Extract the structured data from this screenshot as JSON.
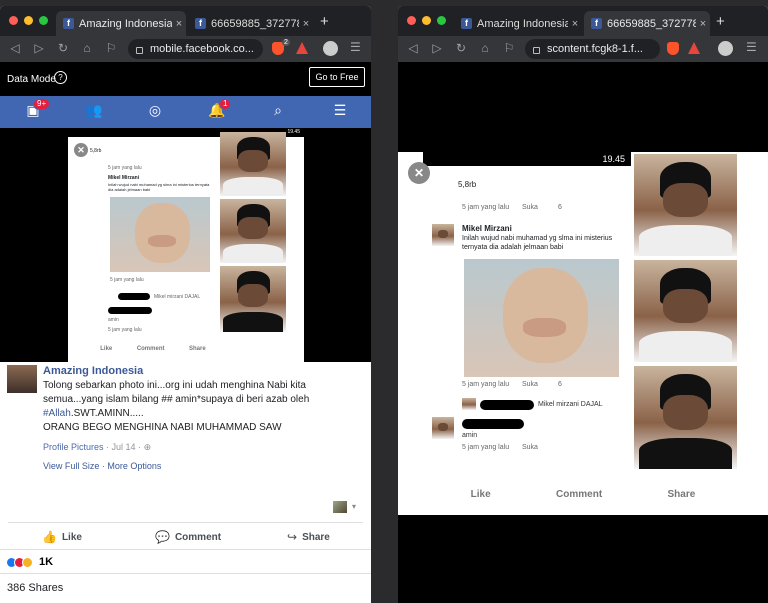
{
  "left_window": {
    "tabs": [
      {
        "title": "Amazing Indonesia -",
        "close": "×"
      },
      {
        "title": "66659885_3727783...",
        "close": "×"
      }
    ],
    "new_tab": "+",
    "url": "mobile.facebook.co...",
    "shield_count": "2",
    "data_mode": {
      "label": "Data Mode",
      "help_icon": "?",
      "button": "Go to Free"
    },
    "nav": {
      "home_badge": "9+",
      "notif_badge": "1"
    },
    "post": {
      "author": "Amazing Indonesia",
      "caption_line1": "Tolong sebarkan photo ini...org ini udah menghina Nabi kita semua...yang islam bilang ## amin*supaya di beri azab oleh",
      "hashtag": "#Allah",
      "caption_line1_end": ".SWT.AMINN.....",
      "caption_line2": "ORANG BEGO MENGHINA NABI MUHAMMAD SAW",
      "album": "Profile Pictures",
      "date": "· Jul 14 ·",
      "view_full": "View Full Size",
      "separator": " · ",
      "more_options": "More Options",
      "like": "Like",
      "comment": "Comment",
      "share": "Share",
      "reaction_count": "1K",
      "shares": "386 Shares"
    }
  },
  "right_window": {
    "tabs": [
      {
        "title": "Amazing Indonesia -",
        "close": "×"
      },
      {
        "title": "66659885_3727783...",
        "close": "×"
      }
    ],
    "new_tab": "+",
    "url": "scontent.fcgk8-1.f...",
    "shot": {
      "status_time": "19.45",
      "react_count": "5,8rb",
      "time_ago": "5 jam yang lalu",
      "suka": "Suka",
      "six": "6",
      "commenter": "Mikel Mirzani",
      "comment": "Inilah wujud nabi muhamad yg slma ini misterius ternyata dia adalah jelmaan babi",
      "tag": "Mikel mirzani DAJAL",
      "reply": "amin",
      "like": "Like",
      "comment_btn": "Comment",
      "share": "Share"
    }
  },
  "colors": {
    "facebook_blue": "#4267b2",
    "badge_red": "#e41e3f",
    "tab_bg": "#202124",
    "toolbar_bg": "#35363a"
  }
}
